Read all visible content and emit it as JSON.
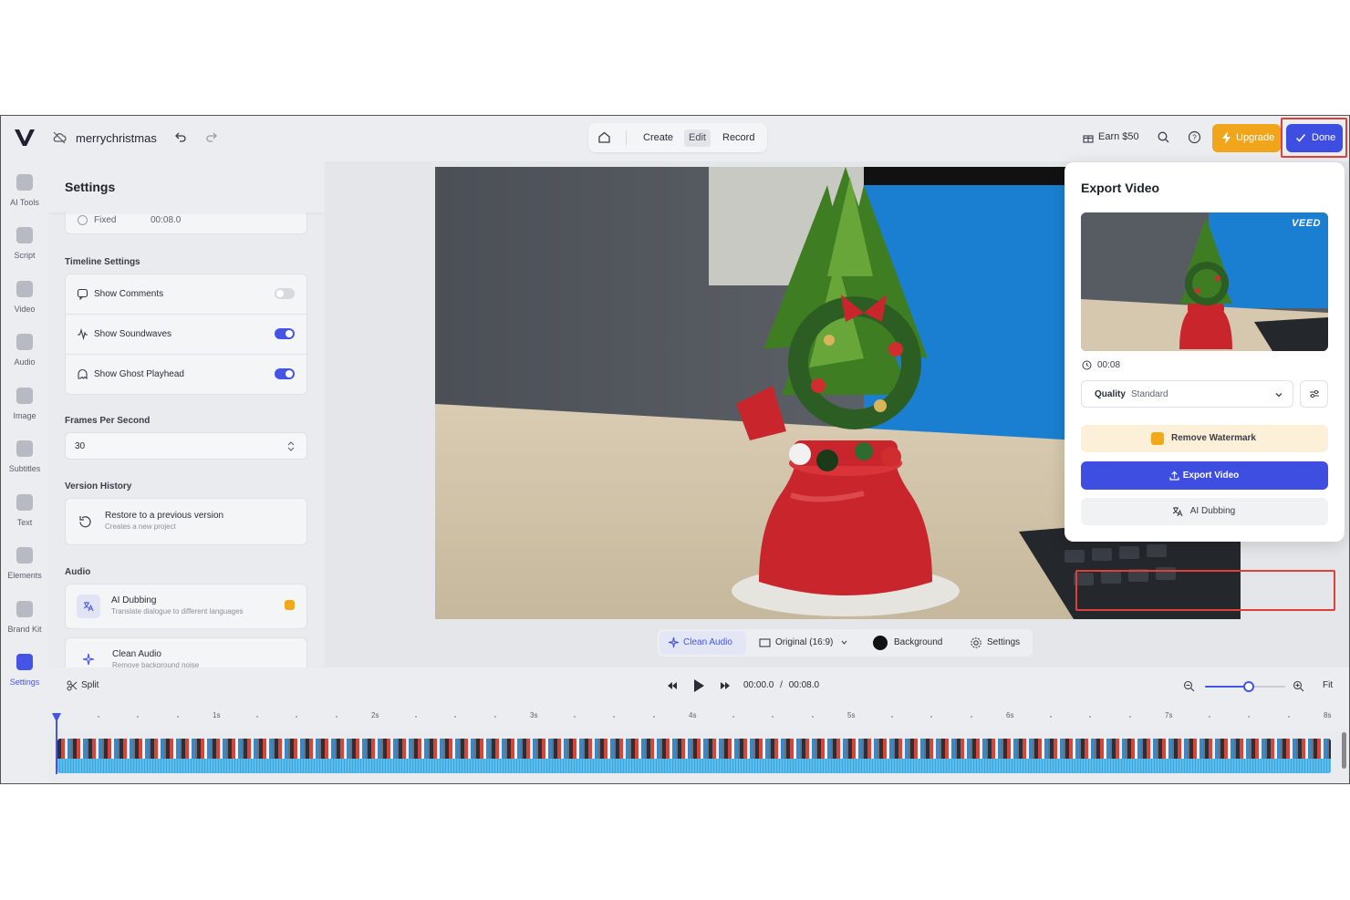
{
  "header": {
    "project_name": "merrychristmas",
    "tabs": [
      "Create",
      "Edit",
      "Record"
    ],
    "active_tab": "Edit",
    "earn_label": "Earn $50",
    "upgrade_label": "Upgrade",
    "done_label": "Done"
  },
  "rail": {
    "items": [
      {
        "label": "AI Tools",
        "icon": "ai-tools-icon"
      },
      {
        "label": "Script",
        "icon": "script-icon"
      },
      {
        "label": "Video",
        "icon": "video-icon"
      },
      {
        "label": "Audio",
        "icon": "audio-icon"
      },
      {
        "label": "Image",
        "icon": "image-icon"
      },
      {
        "label": "Subtitles",
        "icon": "subtitles-icon"
      },
      {
        "label": "Text",
        "icon": "text-icon"
      },
      {
        "label": "Elements",
        "icon": "elements-icon"
      },
      {
        "label": "Brand Kit",
        "icon": "brand-kit-icon"
      },
      {
        "label": "Settings",
        "icon": "settings-icon"
      }
    ],
    "active": "Settings"
  },
  "settings": {
    "title": "Settings",
    "fixed_label": "Fixed",
    "fixed_value": "00:08.0",
    "timeline_section": "Timeline Settings",
    "show_comments": "Show Comments",
    "show_soundwaves": "Show Soundwaves",
    "show_ghost_playhead": "Show Ghost Playhead",
    "toggles": {
      "comments": false,
      "soundwaves": true,
      "ghost_playhead": true
    },
    "fps_section": "Frames Per Second",
    "fps_value": "30",
    "version_section": "Version History",
    "restore_title": "Restore to a previous version",
    "restore_sub": "Creates a new project",
    "audio_section": "Audio",
    "ai_dubbing_title": "AI Dubbing",
    "ai_dubbing_sub": "Translate dialogue to different languages",
    "clean_audio_title": "Clean Audio",
    "clean_audio_sub": "Remove background noise"
  },
  "preview_bar": {
    "clean_audio": "Clean Audio",
    "aspect": "Original (16:9)",
    "background": "Background",
    "settings": "Settings"
  },
  "export": {
    "title": "Export Video",
    "watermark": "VEED",
    "duration": "00:08",
    "quality_label": "Quality",
    "quality_value": "Standard",
    "remove_watermark": "Remove Watermark",
    "export_button": "Export Video",
    "ai_dubbing": "AI Dubbing"
  },
  "timeline": {
    "split_label": "Split",
    "current_time": "00:00.0",
    "separator": "/",
    "total_time": "00:08.0",
    "fit_label": "Fit",
    "zoom_level": 0.55,
    "ruler_labels": [
      "1s",
      "2s",
      "3s",
      "4s",
      "5s",
      "6s",
      "7s",
      "8s"
    ]
  },
  "colors": {
    "accent": "#3d4ee0",
    "upgrade": "#f0a51a",
    "highlight": "#e0403a",
    "track": "#3aa7e0"
  }
}
